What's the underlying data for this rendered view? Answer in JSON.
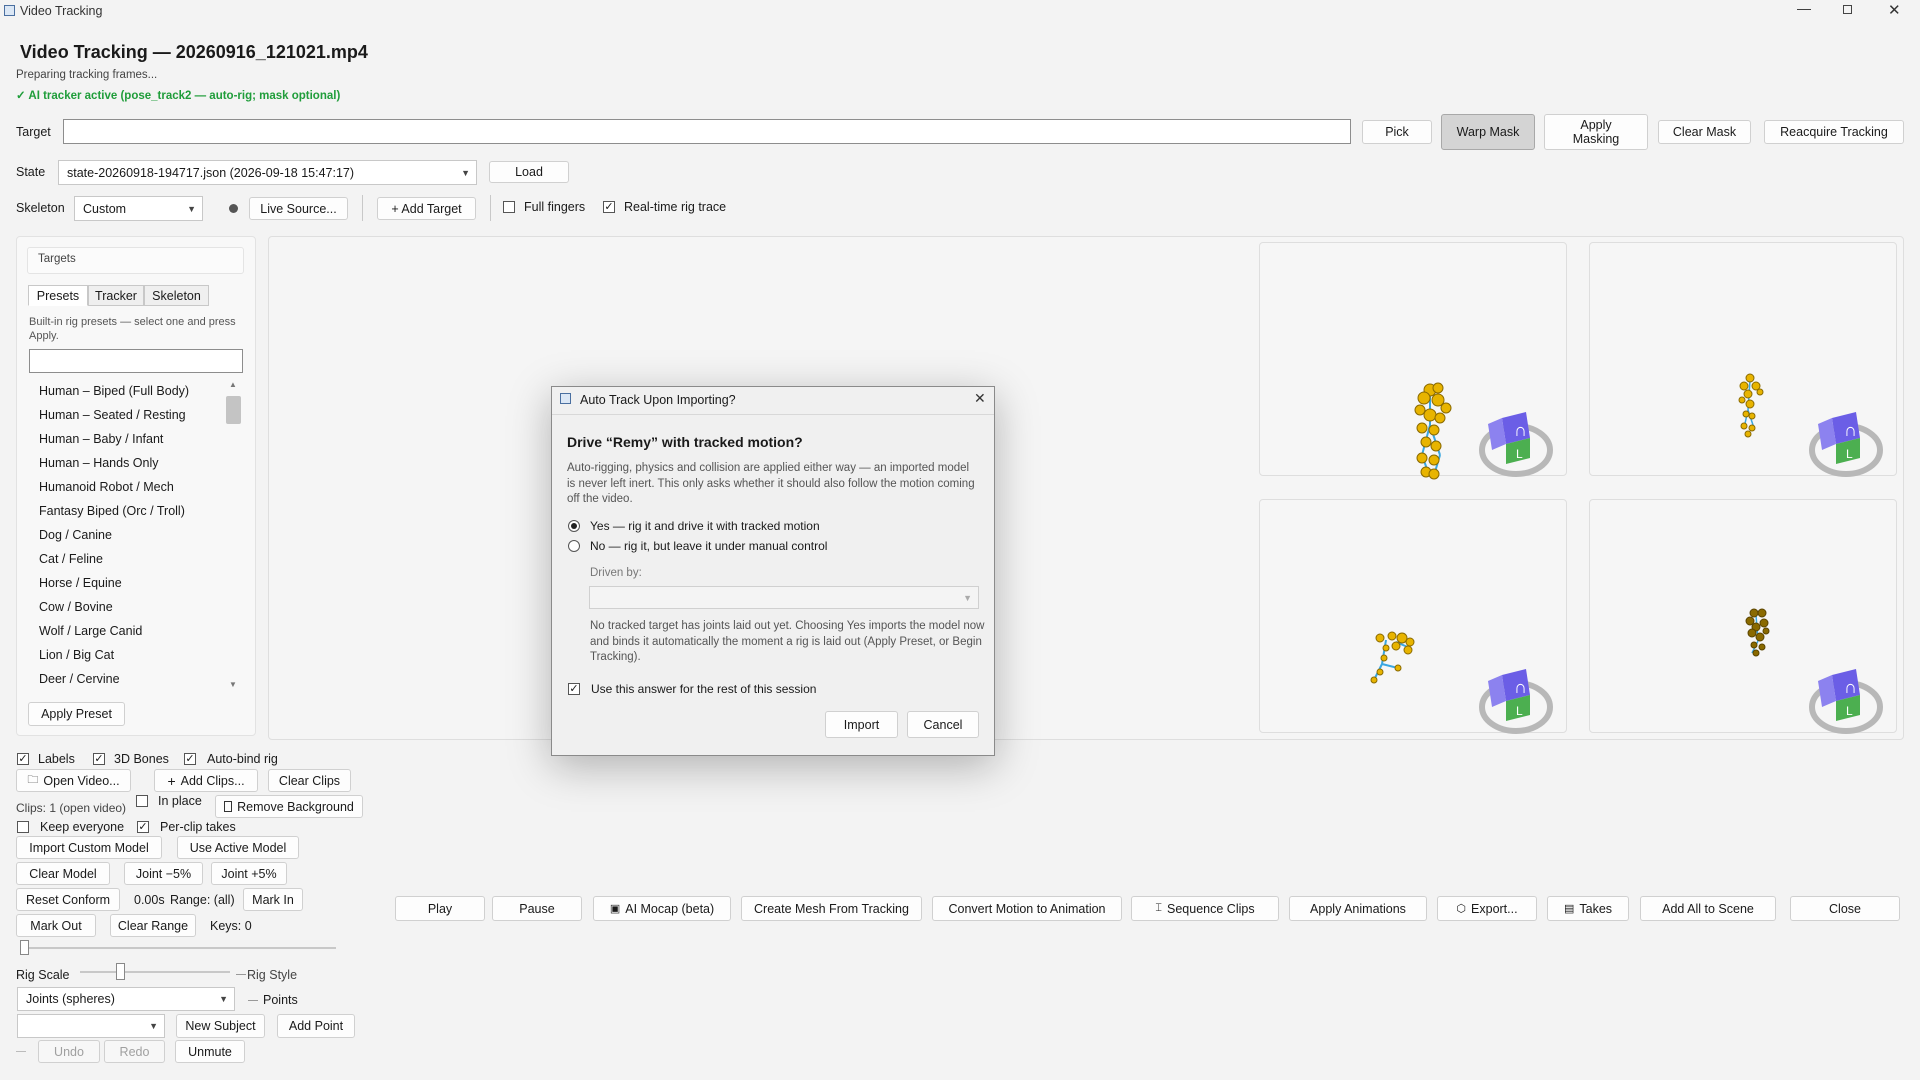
{
  "window": {
    "title": "Video Tracking"
  },
  "header": {
    "title": "Video Tracking — 20260916_121021.mp4",
    "status": "Preparing tracking frames...",
    "tracker_status": "✓ AI tracker active (pose_track2 — auto-rig; mask optional)"
  },
  "target_row": {
    "label": "Target",
    "input_value": "",
    "pick": "Pick",
    "warp_mask": "Warp Mask",
    "apply_masking_1": "Apply",
    "apply_masking_2": "Masking",
    "clear_mask": "Clear Mask",
    "reacquire": "Reacquire Tracking"
  },
  "state_row": {
    "label": "State",
    "value": "state-20260918-194717.json (2026-09-18 15:47:17)",
    "load": "Load"
  },
  "skeleton_row": {
    "label": "Skeleton",
    "value": "Custom",
    "live_source": "Live Source...",
    "add_target": "+ Add Target",
    "full_fingers": "Full fingers",
    "full_fingers_checked": false,
    "realtime_trace": "Real-time rig trace",
    "realtime_trace_checked": true
  },
  "targets_panel": {
    "title": "Targets",
    "tabs": [
      "Presets",
      "Tracker",
      "Skeleton"
    ],
    "description": "Built-in rig presets — select one and press Apply.",
    "filter_value": "",
    "presets": [
      "Human – Biped (Full Body)",
      "Human – Seated / Resting",
      "Human – Baby / Infant",
      "Human – Hands Only",
      "Humanoid Robot / Mech",
      "Fantasy Biped (Orc / Troll)",
      "Dog / Canine",
      "Cat / Feline",
      "Horse / Equine",
      "Cow / Bovine",
      "Wolf / Large Canid",
      "Lion / Big Cat",
      "Deer / Cervine"
    ],
    "apply_preset": "Apply Preset"
  },
  "options": {
    "labels": "Labels",
    "bones3d": "3D Bones",
    "autobind": "Auto-bind rig",
    "open_video": "Open Video...",
    "add_clips": "Add Clips...",
    "clear_clips": "Clear Clips",
    "clips_info": "Clips: 1 (open video)",
    "in_place": "In place",
    "remove_bg": "Remove Background",
    "keep_everyone": "Keep everyone",
    "per_clip_takes": "Per-clip takes",
    "import_custom": "Import Custom Model",
    "use_active": "Use Active Model",
    "clear_model": "Clear Model",
    "joint_minus": "Joint −5%",
    "joint_plus": "Joint +5%",
    "reset_conform": "Reset Conform",
    "time": "0.00s",
    "range": "Range: (all)",
    "mark_in": "Mark In",
    "mark_out": "Mark Out",
    "clear_range": "Clear Range",
    "keys": "Keys: 0",
    "rig_scale": "Rig Scale",
    "rig_style": "Rig Style",
    "rig_style_value": "Joints (spheres)",
    "points": "Points",
    "new_subject": "New Subject",
    "add_point": "Add Point",
    "undo": "Undo",
    "redo": "Redo",
    "unmute": "Unmute"
  },
  "toolbar": {
    "play": "Play",
    "pause": "Pause",
    "ai_mocap": "AI Mocap (beta)",
    "create_mesh": "Create Mesh From Tracking",
    "convert_motion": "Convert Motion to Animation",
    "sequence_clips": "Sequence Clips",
    "apply_animations": "Apply Animations",
    "export": "Export...",
    "takes": "Takes",
    "add_all": "Add All to Scene",
    "close": "Close"
  },
  "dialog": {
    "title": "Auto Track Upon Importing?",
    "heading": "Drive “Remy” with tracked motion?",
    "body": "Auto-rigging, physics and collision are applied either way — an imported model is never left inert. This only asks whether it should also follow the motion coming off the video.",
    "option_yes": "Yes — rig it and drive it with tracked motion",
    "option_no": "No — rig it, but leave it under manual control",
    "driven_by_label": "Driven by:",
    "driven_by_value": "",
    "note": "No tracked target has joints laid out yet. Choosing Yes imports the model now and binds it automatically the moment a rig is laid out (Apply Preset, or Begin Tracking).",
    "remember": "Use this answer for the rest of this session",
    "import": "Import",
    "cancel": "Cancel"
  },
  "colors": {
    "accent_green": "#1f9d3a",
    "joint_yellow": "#e8b400",
    "bone_blue": "#39a6e0",
    "cube_purple": "#6b5ee6",
    "cube_green": "#4caf50"
  }
}
